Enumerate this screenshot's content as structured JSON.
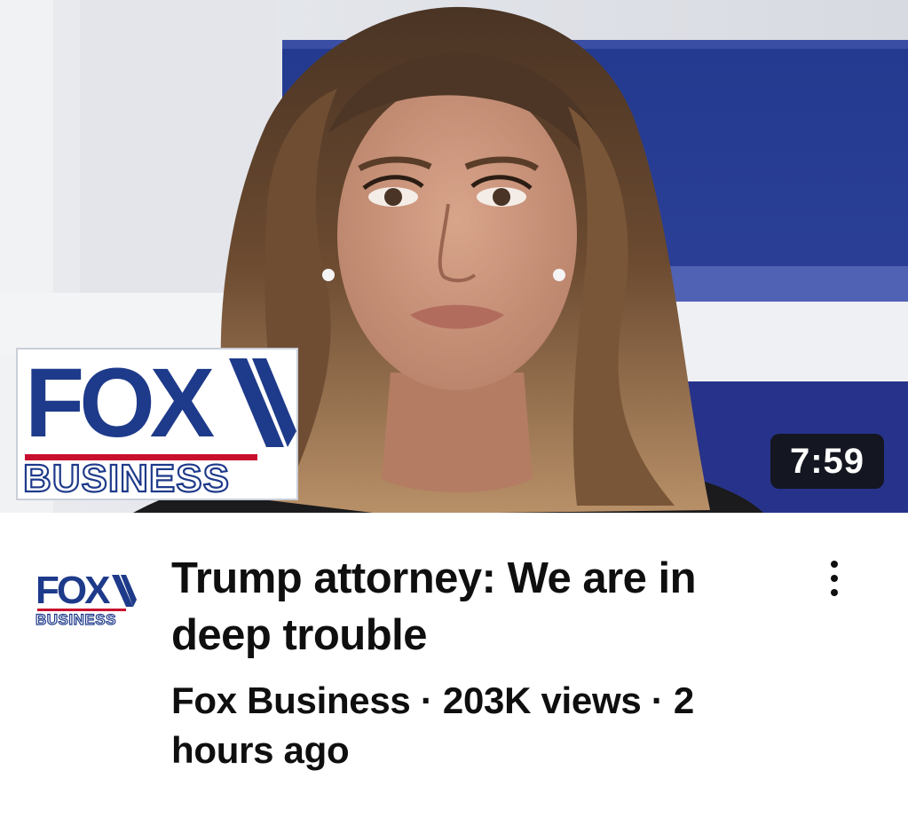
{
  "video": {
    "duration": "7:59",
    "title": "Trump attorney: We are in deep trouble",
    "channel": "Fox Business",
    "views": "203K views",
    "age": "2 hours ago",
    "separator": "·"
  },
  "thumbnail": {
    "logo_top": "FOX",
    "logo_bottom": "BUSINESS"
  },
  "avatar": {
    "logo_top": "FOX",
    "logo_bottom": "BUSINESS"
  },
  "icons": {
    "more": "more-vertical-icon"
  },
  "colors": {
    "fox_blue": "#1e3a8a",
    "fox_red": "#c8102e",
    "text": "#0f0f0f",
    "duration_bg": "#121212"
  }
}
